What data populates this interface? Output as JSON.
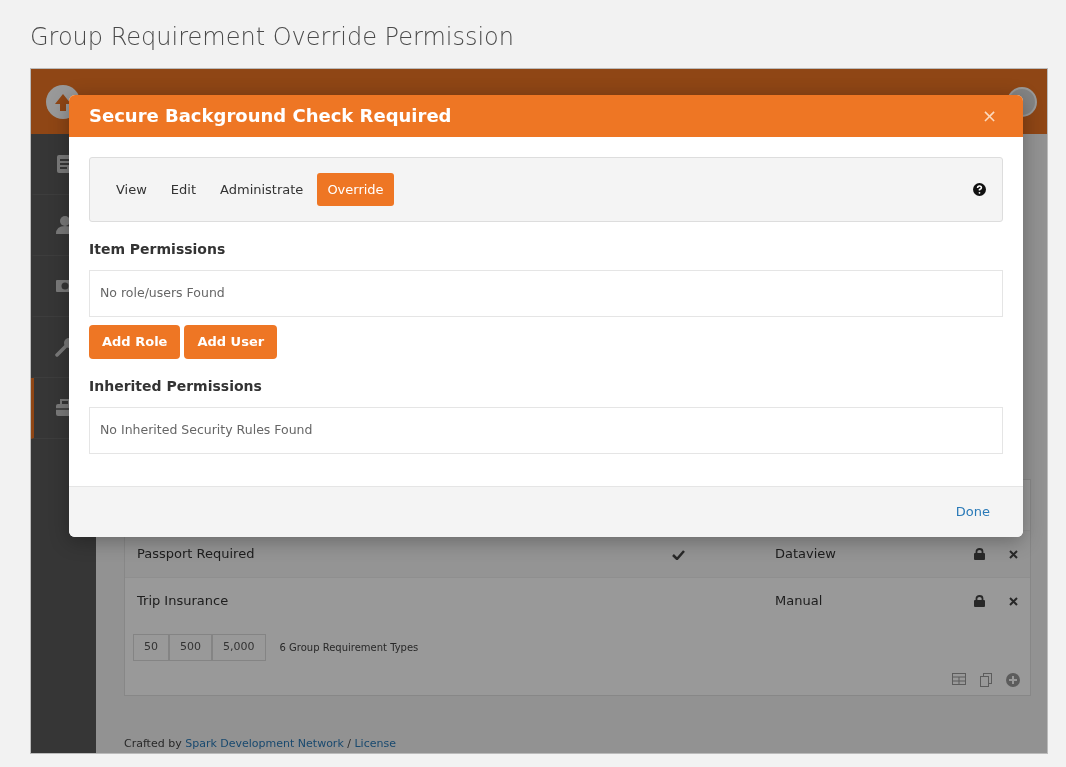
{
  "page_title": "Group Requirement Override Permission",
  "sidebar": [
    {
      "selected": false
    },
    {
      "selected": false
    },
    {
      "selected": false
    },
    {
      "selected": false
    },
    {
      "selected": true
    }
  ],
  "table": {
    "rows": [
      {
        "name": "Passport Required",
        "checked": true,
        "type": "Dataview"
      },
      {
        "name": "Trip Insurance",
        "checked": false,
        "type": "Manual"
      }
    ],
    "page_sizes": [
      "50",
      "500",
      "5,000"
    ],
    "count": "6 Group Requirement Types"
  },
  "footer": {
    "prefix": "Crafted by",
    "link": "Spark Development Network",
    "separator": "/",
    "license": "License"
  },
  "modal": {
    "title": "Secure Background Check Required",
    "close": "×",
    "tabs": [
      {
        "label": "View",
        "selected": false
      },
      {
        "label": "Edit",
        "selected": false
      },
      {
        "label": "Administrate",
        "selected": false
      },
      {
        "label": "Override",
        "selected": true
      }
    ],
    "sections": [
      {
        "heading": "Item Permissions",
        "empty_text": "No role/users Found",
        "buttons": [
          "Add Role",
          "Add User"
        ]
      },
      {
        "heading": "Inherited Permissions",
        "empty_text": "No Inherited Security Rules Found"
      }
    ],
    "done": "Done"
  }
}
